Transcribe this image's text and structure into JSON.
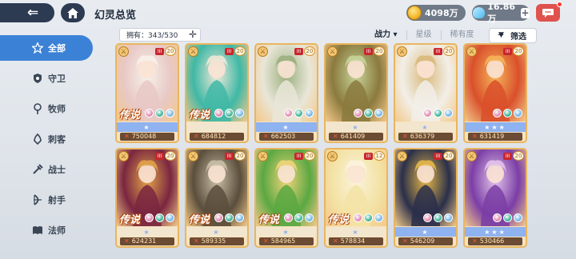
{
  "header": {
    "title": "幻灵总览",
    "gold": "4098万",
    "gems": "16.86万"
  },
  "owned": {
    "label": "拥有：343/530"
  },
  "sort": {
    "options": [
      "战力 ▾",
      "星级",
      "稀有度"
    ],
    "filter_label": "筛选"
  },
  "sidebar": {
    "items": [
      {
        "label": "全部",
        "icon": "all-icon",
        "active": true
      },
      {
        "label": "守卫",
        "icon": "shield-icon"
      },
      {
        "label": "牧师",
        "icon": "staff-icon"
      },
      {
        "label": "刺客",
        "icon": "dagger-icon"
      },
      {
        "label": "战士",
        "icon": "sword-icon"
      },
      {
        "label": "射手",
        "icon": "bow-icon"
      },
      {
        "label": "法师",
        "icon": "book-icon"
      }
    ]
  },
  "colors": {
    "accent": "#3b82d6",
    "nav_bg": "#2c3a52",
    "card_border": "#e9b560"
  },
  "cards": [
    {
      "level": "20",
      "rarity": "传说",
      "power": "750048",
      "star_bar": "blue",
      "stars": 1,
      "art": "#e8c8c5",
      "art2": "#f7f1ea"
    },
    {
      "level": "20",
      "rarity": "传说",
      "power": "684812",
      "star_bar": "pale",
      "stars": 0,
      "art": "#3fb8a6",
      "art2": "#f0e8d6"
    },
    {
      "level": "20",
      "rarity": "",
      "power": "662503",
      "star_bar": "blue",
      "stars": 1,
      "art": "#e9e6d8",
      "art2": "#9bb07e"
    },
    {
      "level": "20",
      "rarity": "",
      "power": "641409",
      "star_bar": "pale",
      "stars": 1,
      "art": "#8b7a3e",
      "art2": "#c7d49a"
    },
    {
      "level": "20",
      "rarity": "",
      "power": "636379",
      "star_bar": "pale",
      "stars": 1,
      "art": "#f2efe9",
      "art2": "#d9b97a"
    },
    {
      "level": "20",
      "rarity": "",
      "power": "631419",
      "star_bar": "blue",
      "stars": 3,
      "art": "#d9502b",
      "art2": "#f5b45a"
    },
    {
      "level": "20",
      "rarity": "传说",
      "power": "624231",
      "star_bar": "pale",
      "stars": 1,
      "art": "#7a2640",
      "art2": "#e1a34a"
    },
    {
      "level": "20",
      "rarity": "传说",
      "power": "589335",
      "star_bar": "pale",
      "stars": 1,
      "art": "#5a4e3c",
      "art2": "#c9bfa6"
    },
    {
      "level": "20",
      "rarity": "传说",
      "power": "584965",
      "star_bar": "pale",
      "stars": 1,
      "art": "#5ba842",
      "art2": "#f0d47a"
    },
    {
      "level": "12",
      "rarity": "传说",
      "power": "578834",
      "star_bar": "pale",
      "stars": 1,
      "art": "#f3e3a6",
      "art2": "#fbf3dd"
    },
    {
      "level": "20",
      "rarity": "",
      "power": "546209",
      "star_bar": "blue",
      "stars": 1,
      "art": "#2a2f4a",
      "art2": "#e6b84a"
    },
    {
      "level": "20",
      "rarity": "",
      "power": "530466",
      "star_bar": "blue",
      "stars": 3,
      "art": "#7b3ea6",
      "art2": "#e3c3ea"
    }
  ]
}
